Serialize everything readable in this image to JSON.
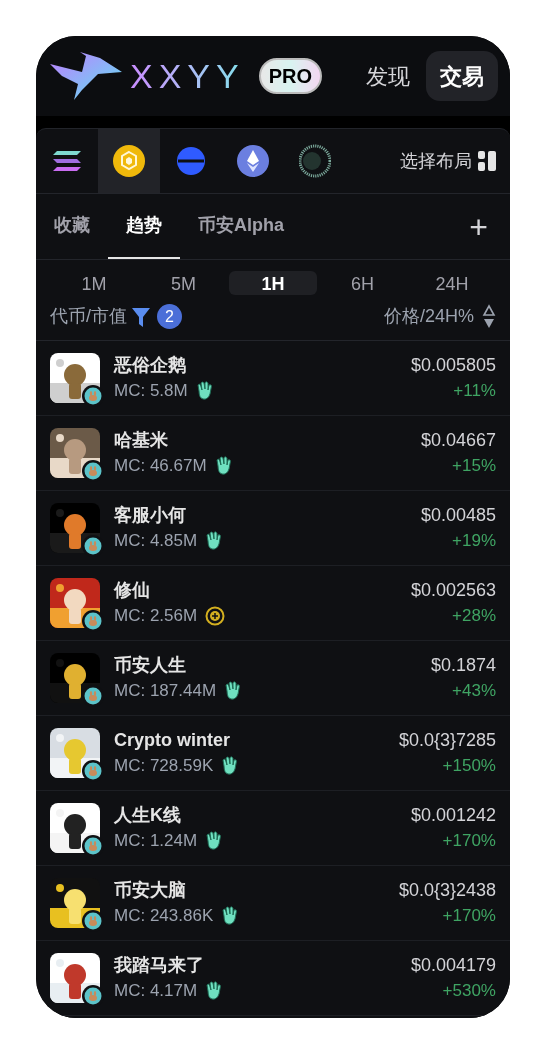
{
  "header": {
    "logo_text": "XXYY",
    "pro_badge": "PRO",
    "nav": [
      {
        "label": "发现",
        "selected": false
      },
      {
        "label": "交易",
        "selected": true
      }
    ]
  },
  "chains": [
    {
      "kind": "stripes",
      "selected": false
    },
    {
      "kind": "bnb",
      "selected": true
    },
    {
      "kind": "base",
      "selected": false
    },
    {
      "kind": "eth",
      "selected": false
    },
    {
      "kind": "ring",
      "selected": false
    }
  ],
  "layout_button": "选择布局",
  "tabs": [
    {
      "label": "收藏",
      "selected": false
    },
    {
      "label": "趋势",
      "selected": true
    },
    {
      "label": "币安Alpha",
      "selected": false
    }
  ],
  "add_tab": "+",
  "timeframes": [
    {
      "label": "1M",
      "selected": false
    },
    {
      "label": "5M",
      "selected": false
    },
    {
      "label": "1H",
      "selected": true
    },
    {
      "label": "6H",
      "selected": false
    },
    {
      "label": "24H",
      "selected": false
    }
  ],
  "list_header": {
    "left": "代币/市值",
    "filter_count": "2",
    "right": "价格/24H%"
  },
  "tokens": [
    {
      "name": "恶俗企鹅",
      "mc": "MC: 5.8M",
      "kind": "hand",
      "price": "$0.005805",
      "change": "+11%"
    },
    {
      "name": "哈基米",
      "mc": "MC: 46.67M",
      "kind": "hand",
      "price": "$0.04667",
      "change": "+15%"
    },
    {
      "name": "客服小何",
      "mc": "MC: 4.85M",
      "kind": "hand",
      "price": "$0.00485",
      "change": "+19%"
    },
    {
      "name": "修仙",
      "mc": "MC: 2.56M",
      "kind": "coin",
      "price": "$0.002563",
      "change": "+28%"
    },
    {
      "name": "币安人生",
      "mc": "MC: 187.44M",
      "kind": "hand",
      "price": "$0.1874",
      "change": "+43%"
    },
    {
      "name": "Crypto winter",
      "mc": "MC: 728.59K",
      "kind": "hand",
      "price": "$0.0{3}7285",
      "change": "+150%"
    },
    {
      "name": "人生K线",
      "mc": "MC: 1.24M",
      "kind": "hand",
      "price": "$0.001242",
      "change": "+170%"
    },
    {
      "name": "币安大脑",
      "mc": "MC: 243.86K",
      "kind": "hand",
      "price": "$0.0{3}2438",
      "change": "+170%"
    },
    {
      "name": "我踏马来了",
      "mc": "MC: 4.17M",
      "kind": "hand",
      "price": "$0.004179",
      "change": "+530%"
    }
  ]
}
